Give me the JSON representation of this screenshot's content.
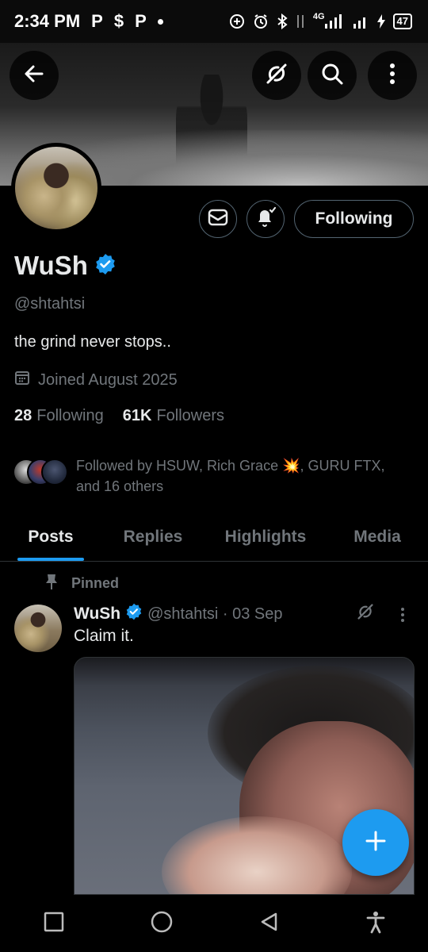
{
  "status_bar": {
    "time": "2:34 PM",
    "apps": [
      "P",
      "$",
      "P"
    ],
    "network": "4G",
    "battery": "47"
  },
  "header": {
    "back_icon": "back-arrow-icon",
    "grok_icon": "grok-icon",
    "search_icon": "search-icon",
    "more_icon": "more-vertical-icon"
  },
  "profile": {
    "name": "WuSh",
    "verified": true,
    "handle": "@shtahtsi",
    "bio": "the grind never stops..",
    "joined": "Joined August 2025",
    "following_count": "28",
    "following_label": "Following",
    "followers_count": "61K",
    "followers_label": "Followers",
    "followed_by": "Followed by HSUW, Rich Grace 💥, GURU FTX, and 16 others",
    "follow_button": "Following"
  },
  "tabs": [
    {
      "label": "Posts",
      "active": true
    },
    {
      "label": "Replies",
      "active": false
    },
    {
      "label": "Highlights",
      "active": false
    },
    {
      "label": "Media",
      "active": false
    }
  ],
  "post": {
    "pinned_label": "Pinned",
    "author": "WuSh",
    "handle_date": "@shtahtsi · 03 Sep",
    "text": "Claim it."
  },
  "colors": {
    "accent": "#1d9bf0",
    "muted": "#71767b",
    "border": "#536471",
    "background": "#000000"
  }
}
